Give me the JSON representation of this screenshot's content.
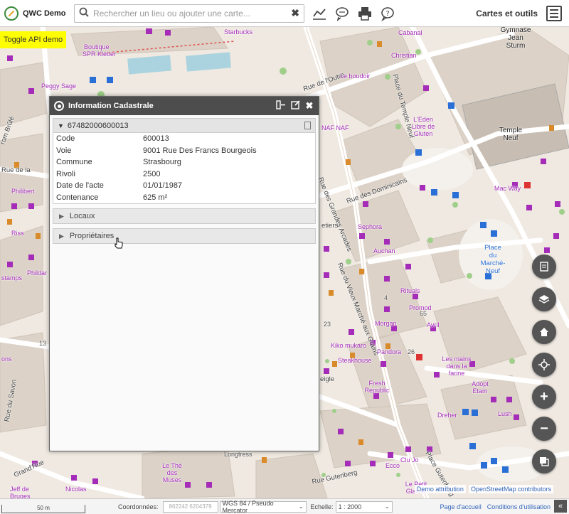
{
  "app": {
    "title": "QWC Demo"
  },
  "search": {
    "placeholder": "Rechercher un lieu ou ajouter une carte..."
  },
  "toolbar": {
    "tools_label": "Cartes et outils"
  },
  "toggle_api": {
    "label": "Toggle API demo"
  },
  "dialog": {
    "title": "Information Cadastrale",
    "parcel": {
      "id": "67482000600013",
      "rows": [
        {
          "key": "Code",
          "value": "600013"
        },
        {
          "key": "Voie",
          "value": "9001 Rue Des Francs Bourgeois"
        },
        {
          "key": "Commune",
          "value": "Strasbourg"
        },
        {
          "key": "Rivoli",
          "value": "2500"
        },
        {
          "key": "Date de l'acte",
          "value": "01/01/1987"
        },
        {
          "key": "Contenance",
          "value": "625 m²"
        }
      ]
    },
    "sections": [
      {
        "label": "Locaux"
      },
      {
        "label": "Propriétaires"
      }
    ]
  },
  "map_labels": {
    "boutique": "Boutique",
    "spr_kleber": "SPR Kleber",
    "peggy_sage": "Peggy Sage",
    "starbucks": "Starbucks",
    "cabanal": "Cabanal",
    "christian": "Christian",
    "rue_outre": "Rue de l'Outre",
    "le_boudoir": "Le boudoir",
    "place_temple_neuf": "Place du Temple Neuf",
    "gymnase_jean_sturm": "Gymnase Jean Sturm",
    "temple_neuf": "Temple Neuf",
    "naf_naf": "NAF NAF",
    "eden_libre": "L'Eden Libre de Gluten",
    "rue_dominicains": "Rue des Dominicains",
    "mac_way": "Mac Way",
    "sephora": "Sephora",
    "auchan": "Auchan",
    "place_marche_neuf": "Place du Marché-Neuf",
    "rue_grandes_arcades": "Rue des Grandes Arcades",
    "rue_vieux_marche_grains": "Rue du Vieux Marché aux Grains",
    "rue_de_la": "Rue de la",
    "philibert": "Philibert",
    "riss": "Riss",
    "phildar": "Phildar",
    "stamps": "stamps",
    "rituals": "Rituals",
    "promod": "Promod",
    "avril": "Avril",
    "morgan": "Morgan",
    "kiko": "Kiko mukaro",
    "pandora": "Pandora",
    "steakhouse": "Steakhouse",
    "fresh_republic": "Fresh Republic",
    "les_mains": "Les mains dans la farine",
    "adopt_etam": "Adopt Etam",
    "dreher": "Dreher",
    "lush": "Lush",
    "rue_du_savon": "Rue du Savon",
    "grand_rue": "Grand'Rue",
    "jeff_de_bruges": "Jeff de Bruges",
    "nicolas": "Nicolas",
    "le_the_des_muses": "Le Thé des Muses",
    "ecco": "Ecco",
    "clu_jo": "Clu Jo",
    "rue_gutenberg": "Rue Gutenberg",
    "place_gutenberg": "Place Gutenberg",
    "le_petit_glacier": "Le Petit Glacier",
    "aiglie": "eigle",
    "bruck": "rom Brûlé",
    "ons": "ons",
    "etiers": "etiers",
    "longtress": "Longtress",
    "n_num_65": "65",
    "n_num_26": "26",
    "n_num_23": "23",
    "n_num_4": "4",
    "n_num_13": "13"
  },
  "attribution": {
    "demo": "Demo attribution",
    "osm": "OpenStreetMap contributors"
  },
  "bottombar": {
    "scale_text": "50 m",
    "coords_label": "Coordonnées:",
    "coords_value": "862242 6204379",
    "crs": "WGS 84 / Pseudo Mercator",
    "scale_label": "Echelle:",
    "scale_value": "1 : 2000",
    "home_link": "Page d'accueil",
    "terms_link": "Conditions d'utilisation"
  },
  "colors": {
    "poi": "#a42cb8",
    "header": "#4d4d4d",
    "highlight": "#ffff00",
    "mapbtn": "#555555"
  }
}
